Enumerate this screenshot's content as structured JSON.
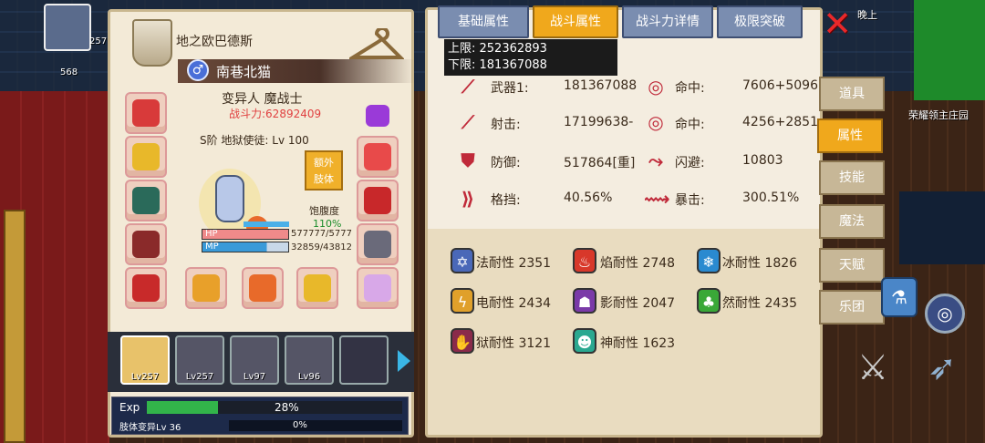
{
  "hero_panel": {
    "title": "地之欧巴德斯",
    "nickname": "南巷北猫",
    "gender_symbol": "♂",
    "class_name": "变异人 魔战士",
    "power": "战斗力:62892409",
    "rank": "S阶 地狱使徒: Lv 100",
    "extra_limb_button": "额外\n肢体",
    "satiety_label": "饱腹度",
    "satiety_value": "110%",
    "hp_label": "HP",
    "hp_value": "577777/5777",
    "hp_fill": 1.0,
    "mp_label": "MP",
    "mp_value": "32859/43812",
    "mp_fill": 0.75
  },
  "party": [
    {
      "level": "Lv257",
      "selected": true
    },
    {
      "level": "Lv257",
      "selected": false
    },
    {
      "level": "Lv97",
      "selected": false
    },
    {
      "level": "Lv96",
      "selected": false
    },
    {
      "level": "",
      "selected": false
    }
  ],
  "exp": {
    "label": "Exp",
    "percent_text": "28%",
    "fill": 0.28,
    "mutation_label": "肢体变异Lv 36",
    "mutation_percent": "0%"
  },
  "tabs": [
    "基础属性",
    "战斗属性",
    "战斗力详情",
    "极限突破"
  ],
  "active_tab": "战斗属性",
  "tooltip": {
    "upper": "上限: 252362893",
    "lower": "下限: 181367088"
  },
  "stats": [
    {
      "icon": "weapon-icon",
      "label": "武器1:",
      "value": "181367088"
    },
    {
      "icon": "hit-icon",
      "label": "命中:",
      "value": "7606+5096"
    },
    {
      "icon": "ranged-icon",
      "label": "射击:",
      "value": "17199638-"
    },
    {
      "icon": "hit-icon",
      "label": "命中:",
      "value": "4256+2851"
    },
    {
      "icon": "shield-icon",
      "label": "防御:",
      "value": "517864[重]"
    },
    {
      "icon": "dodge-icon",
      "label": "闪避:",
      "value": "10803"
    },
    {
      "icon": "block-icon",
      "label": "格挡:",
      "value": "40.56%"
    },
    {
      "icon": "crit-icon",
      "label": "暴击:",
      "value": "300.51%"
    }
  ],
  "resistances": [
    {
      "icon": "magic-resist-icon",
      "text": "法耐性 2351",
      "color": "#4a68b8"
    },
    {
      "icon": "fire-resist-icon",
      "text": "焰耐性 2748",
      "color": "#d8382a"
    },
    {
      "icon": "ice-resist-icon",
      "text": "冰耐性 1826",
      "color": "#2a8ad0"
    },
    {
      "icon": "lightning-resist-icon",
      "text": "电耐性 2434",
      "color": "#e0a02a"
    },
    {
      "icon": "shadow-resist-icon",
      "text": "影耐性 2047",
      "color": "#7a3aa8"
    },
    {
      "icon": "nature-resist-icon",
      "text": "然耐性 2435",
      "color": "#3aa838"
    },
    {
      "icon": "hell-resist-icon",
      "text": "狱耐性 3121",
      "color": "#8a2a4a"
    },
    {
      "icon": "spirit-resist-icon",
      "text": "神耐性 1623",
      "color": "#2aa890"
    }
  ],
  "side_menu": [
    "道具",
    "属性",
    "技能",
    "魔法",
    "天赋",
    "乐团"
  ],
  "side_active": "属性",
  "hud": {
    "player_level": "257",
    "coins": "568",
    "location_label": "荣耀领主庄园",
    "top_right_text": "晚上"
  }
}
